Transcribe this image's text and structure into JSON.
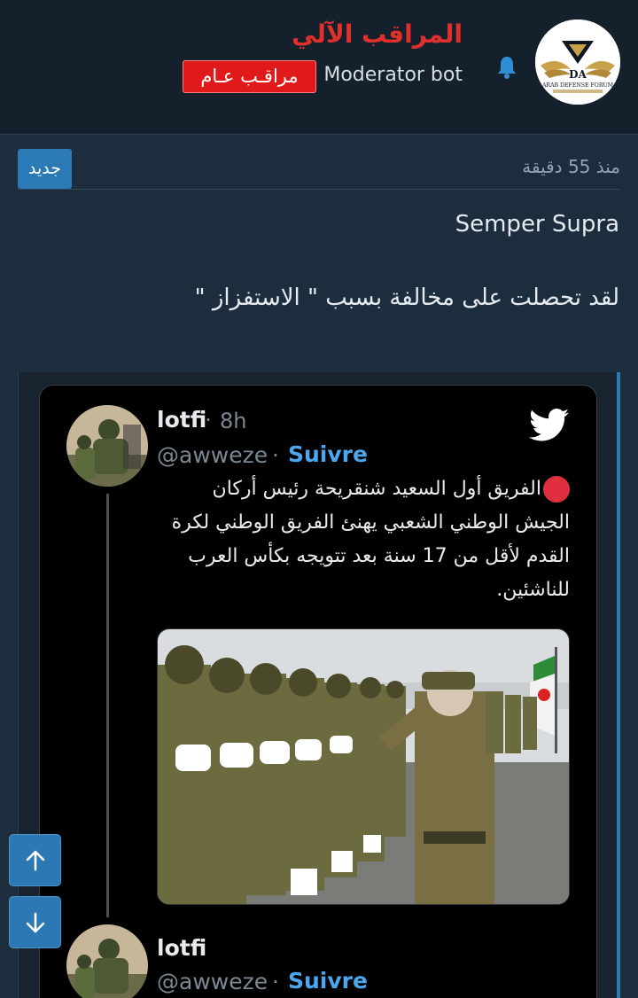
{
  "header": {
    "username": "المراقب الآلي",
    "user_title": "Moderator bot",
    "role_badge": "مراقـب عـام",
    "logo_text_top": "DA",
    "logo_text_bottom": "ARAB DEFENSE FORUM"
  },
  "post_meta": {
    "timestamp": "منذ 55 دقيقة",
    "new_badge": "جديد"
  },
  "post_body": {
    "line1": "Semper Supra",
    "line2": "لقد تحصلت على مخالفة بسبب \" الاستفزاز \""
  },
  "tweet": {
    "name": "lotfi",
    "time": "8h",
    "handle": "@awweze",
    "follow_label": "Suivre",
    "text": "الفريق أول السعيد شنقريحة رئيس أركان الجيش الوطني الشعبي يهنئ الفريق الوطني لكرة القدم لأقل من 17 سنة بعد تتويجه بكأس العرب للناشئين.",
    "separator": "·"
  },
  "tweet2": {
    "name": "lotfi",
    "handle": "@awweze",
    "follow_label": "Suivre"
  },
  "colors": {
    "accent": "#2b79b5",
    "username_red": "#e0302b",
    "twitter_blue": "#1d9bf0"
  },
  "icons": [
    "bell-icon",
    "twitter-bird-icon",
    "arrow-up-icon",
    "arrow-down-icon"
  ]
}
